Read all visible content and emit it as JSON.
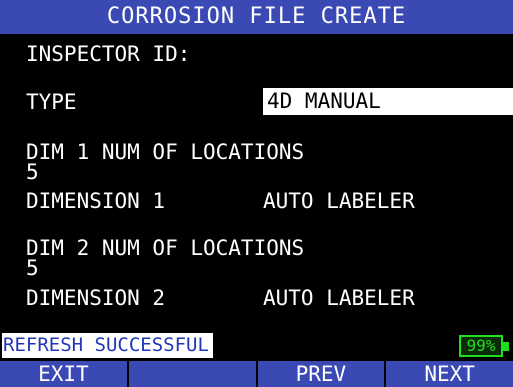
{
  "title": "CORROSION FILE CREATE",
  "fields": {
    "inspector_id_label": "INSPECTOR ID:",
    "type_label": "TYPE",
    "type_value": "4D MANUAL",
    "dim1_locations_label": "DIM 1 NUM OF LOCATIONS",
    "dim1_locations_value": "5",
    "dimension1_label": "DIMENSION 1",
    "dimension1_value": "AUTO LABELER",
    "dim2_locations_label": "DIM 2 NUM OF LOCATIONS",
    "dim2_locations_value": "5",
    "dimension2_label": "DIMENSION 2",
    "dimension2_value": "AUTO LABELER"
  },
  "status": {
    "message": "REFRESH SUCCESSFUL",
    "battery": "99%"
  },
  "softkeys": [
    "EXIT",
    "",
    "PREV",
    "NEXT"
  ],
  "colors": {
    "header_bg": "#3a49b3",
    "background": "#000000",
    "text": "#ffffff",
    "status_text": "#2237b8",
    "battery": "#1fe01f"
  },
  "icons": {
    "battery": "battery-icon"
  }
}
